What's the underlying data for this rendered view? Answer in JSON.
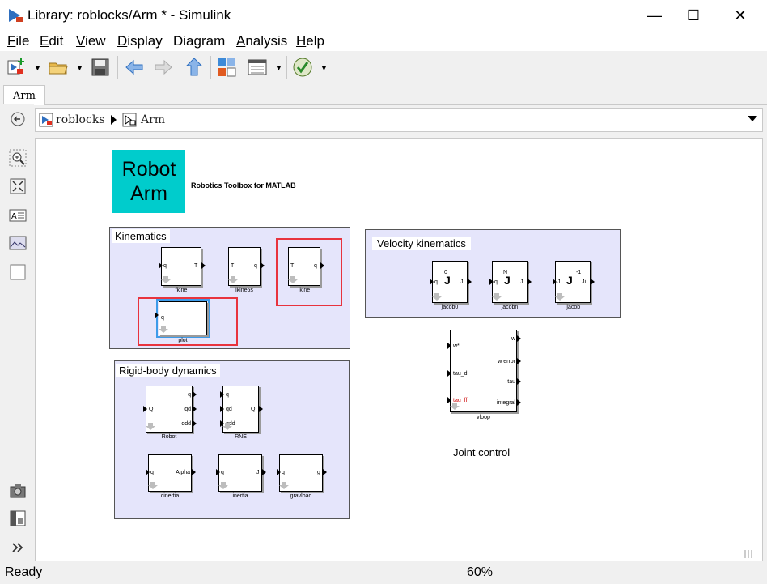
{
  "window": {
    "title": "Library: roblocks/Arm * - Simulink",
    "minimize": "—",
    "maximize": "☐",
    "close": "✕"
  },
  "menu": [
    {
      "mn": "F",
      "rest": "ile"
    },
    {
      "mn": "E",
      "rest": "dit"
    },
    {
      "mn": "V",
      "rest": "iew"
    },
    {
      "mn": "D",
      "rest": "isplay"
    },
    {
      "mn": "",
      "rest": "Diagram"
    },
    {
      "mn": "A",
      "rest": "nalysis"
    },
    {
      "mn": "H",
      "rest": "elp"
    }
  ],
  "tab": {
    "label": "Arm"
  },
  "breadcrumb": {
    "root": "roblocks",
    "current": "Arm"
  },
  "status": {
    "text": "Ready",
    "zoom": "60%"
  },
  "diagram": {
    "logo": {
      "line1": "Robot",
      "line2": "Arm",
      "caption": "Robotics Toolbox for MATLAB",
      "color": "#00cccc"
    },
    "kinematics": {
      "title": "Kinematics",
      "fkine": {
        "in": "q",
        "out": "T",
        "name": "fkine"
      },
      "ikine6s": {
        "in": "T",
        "out": "q",
        "name": "ikine6s"
      },
      "ikine": {
        "in": "T",
        "out": "q",
        "name": "ikine"
      },
      "plot": {
        "in": "q",
        "name": "plot"
      }
    },
    "velocity": {
      "title": "Velocity kinematics",
      "jacob0": {
        "in": "q",
        "out": "J",
        "sym": "J",
        "sup": "0",
        "name": "jacob0"
      },
      "jacobn": {
        "in": "q",
        "out": "J",
        "sym": "J",
        "sup": "N",
        "name": "jacobn"
      },
      "ijacob": {
        "in": "J",
        "out": "Ji",
        "sym": "J",
        "sup": "-1",
        "name": "ijacob"
      }
    },
    "vloop": {
      "in1": "w*",
      "in2": "tau_d",
      "in3": "tau_ff",
      "out1": "w",
      "out2": "w error",
      "out3": "tau",
      "out4": "integral",
      "name": "vloop",
      "caption": "Joint control"
    },
    "dynamics": {
      "title": "Rigid-body dynamics",
      "robot": {
        "in": "Q",
        "o1": "q",
        "o2": "qd",
        "o3": "qdd",
        "name": "Robot"
      },
      "rne": {
        "i1": "q",
        "i2": "qd",
        "i3": "qdd",
        "out": "Q",
        "name": "RNE"
      },
      "cinertia": {
        "in": "q",
        "out": "Alpha",
        "name": "cinertia"
      },
      "inertia": {
        "in": "q",
        "out": "J",
        "name": "inertia"
      },
      "gravload": {
        "in": "q",
        "out": "g",
        "name": "gravload"
      }
    }
  },
  "colors": {
    "highlight": "#e8333d",
    "selected": "#3d9be9",
    "subsystem_bg": "#e5e5fb",
    "tau_ff": "#cc0000"
  }
}
